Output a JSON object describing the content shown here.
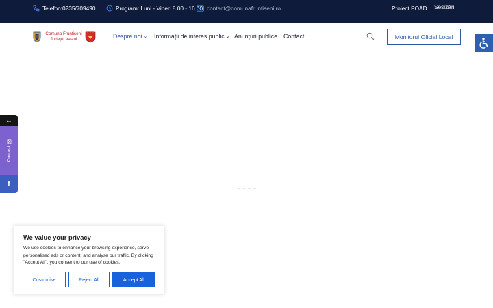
{
  "topbar": {
    "phone": "Telefon:0235/709490",
    "hours": "Program: Luni - Vineri 8.00 - 16.00",
    "email": "contact@comunafruntiseni.ro",
    "poad": "Proiect POAD",
    "sesizari": "Sesizări"
  },
  "logo": {
    "line1": "Comuna Fruntișeni",
    "line2": "Județul Vaslui"
  },
  "nav": {
    "items": [
      {
        "label": "Despre noi",
        "has_dropdown": true,
        "active": true
      },
      {
        "label": "Informații de interes public",
        "has_dropdown": true,
        "active": false
      },
      {
        "label": "Anunțuri publice",
        "has_dropdown": false,
        "active": false
      },
      {
        "label": "Contact",
        "has_dropdown": false,
        "active": false
      }
    ],
    "search_icon": "search-icon",
    "cta": "Monitorul Oficial Local"
  },
  "side": {
    "toggle": "←",
    "contact": "Contact",
    "facebook": "f"
  },
  "cookie": {
    "title": "We value your privacy",
    "text": "We use cookies to enhance your browsing experience, serve personalised ads or content, and analyse our traffic. By clicking \"Accept All\", you consent to our use of cookies.",
    "customise": "Customise",
    "reject": "Reject All",
    "accept": "Accept All"
  },
  "colors": {
    "topbar_bg": "#0e1b3b",
    "accent": "#2f57a6",
    "cookie_accent": "#1863dc",
    "contact_purple": "#7d62cf",
    "facebook_blue": "#3b5ec0"
  }
}
